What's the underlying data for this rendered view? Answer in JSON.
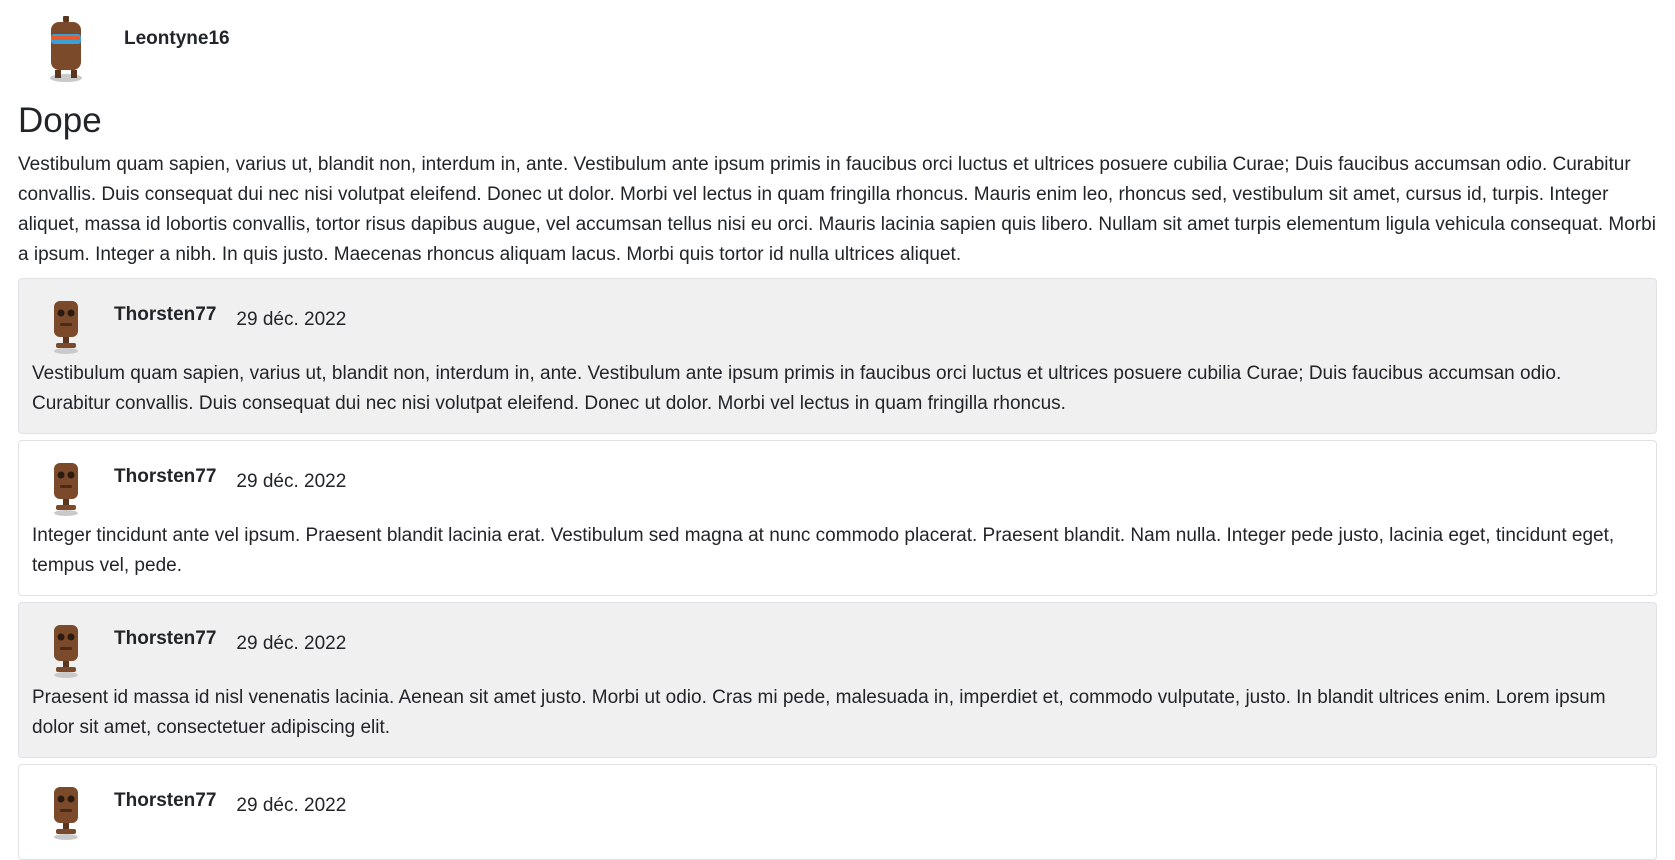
{
  "post": {
    "author": "Leontyne16",
    "title": "Dope",
    "body": "Vestibulum quam sapien, varius ut, blandit non, interdum in, ante. Vestibulum ante ipsum primis in faucibus orci luctus et ultrices posuere cubilia Curae; Duis faucibus accumsan odio. Curabitur convallis. Duis consequat dui nec nisi volutpat eleifend. Donec ut dolor. Morbi vel lectus in quam fringilla rhoncus. Mauris enim leo, rhoncus sed, vestibulum sit amet, cursus id, turpis. Integer aliquet, massa id lobortis convallis, tortor risus dapibus augue, vel accumsan tellus nisi eu orci. Mauris lacinia sapien quis libero. Nullam sit amet turpis elementum ligula vehicula consequat. Morbi a ipsum. Integer a nibh. In quis justo. Maecenas rhoncus aliquam lacus. Morbi quis tortor id nulla ultrices aliquet."
  },
  "comments": [
    {
      "author": "Thorsten77",
      "date": "29 déc. 2022",
      "text": "Vestibulum quam sapien, varius ut, blandit non, interdum in, ante. Vestibulum ante ipsum primis in faucibus orci luctus et ultrices posuere cubilia Curae; Duis faucibus accumsan odio. Curabitur convallis. Duis consequat dui nec nisi volutpat eleifend. Donec ut dolor. Morbi vel lectus in quam fringilla rhoncus."
    },
    {
      "author": "Thorsten77",
      "date": "29 déc. 2022",
      "text": "Integer tincidunt ante vel ipsum. Praesent blandit lacinia erat. Vestibulum sed magna at nunc commodo placerat. Praesent blandit. Nam nulla. Integer pede justo, lacinia eget, tincidunt eget, tempus vel, pede."
    },
    {
      "author": "Thorsten77",
      "date": "29 déc. 2022",
      "text": "Praesent id massa id nisl venenatis lacinia. Aenean sit amet justo. Morbi ut odio. Cras mi pede, malesuada in, imperdiet et, commodo vulputate, justo. In blandit ultrices enim. Lorem ipsum dolor sit amet, consectetuer adipiscing elit."
    },
    {
      "author": "Thorsten77",
      "date": "29 déc. 2022",
      "text": ""
    }
  ],
  "colors": {
    "comment_shaded_bg": "#f0f0f0",
    "border": "#dee2e6",
    "robot_body": "#7a4a2a",
    "robot_visor": "#3aa0d8"
  },
  "icons": {
    "post_avatar": "robot-avatar-icon",
    "comment_avatar": "robot-avatar-icon"
  }
}
